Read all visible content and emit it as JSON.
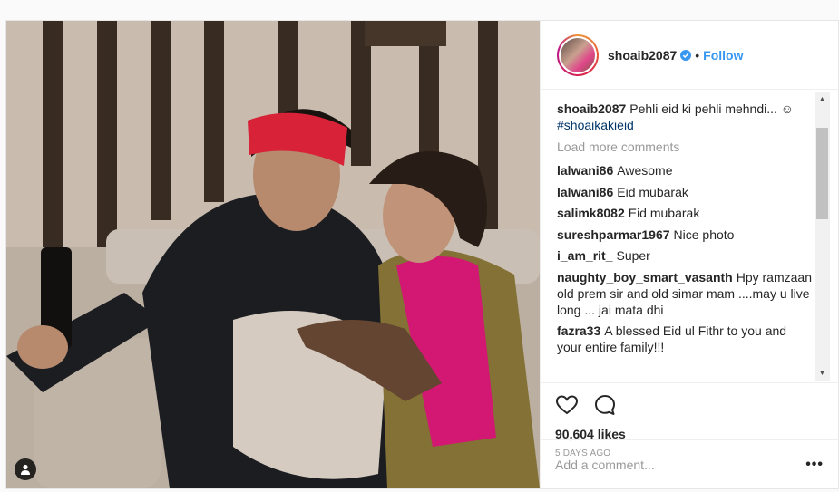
{
  "post": {
    "author": "shoaib2087",
    "follow_label": "Follow",
    "separator": "•",
    "caption_user": "shoaib2087",
    "caption_text": "Pehli eid ki pehli mehndi... ☺",
    "caption_hashtag": "#shoaikakieid",
    "load_more": "Load more comments",
    "likes": "90,604 likes",
    "time": "5 DAYS AGO",
    "add_comment_placeholder": "Add a comment...",
    "more_label": "•••"
  },
  "comments": [
    {
      "user": "lalwani86",
      "text": "Awesome"
    },
    {
      "user": "lalwani86",
      "text": "Eid mubarak"
    },
    {
      "user": "salimk8082",
      "text": "Eid mubarak"
    },
    {
      "user": "sureshparmar1967",
      "text": "Nice photo"
    },
    {
      "user": "i_am_rit_",
      "text": "Super"
    },
    {
      "user": "naughty_boy_smart_vasanth",
      "text": "Hpy ramzaan old prem sir and old simar mam ....may u live long ... jai mata dhi"
    },
    {
      "user": "fazra33",
      "text": "A blessed Eid ul Fithr to you and your entire family!!!"
    }
  ],
  "icons": {
    "like": "heart-icon",
    "comment": "comment-bubble-icon",
    "verified": "verified-badge-icon",
    "user_tag": "user-tag-icon"
  },
  "colors": {
    "link": "#3897f0",
    "hashtag": "#003569",
    "muted": "#999999",
    "text": "#262626"
  }
}
